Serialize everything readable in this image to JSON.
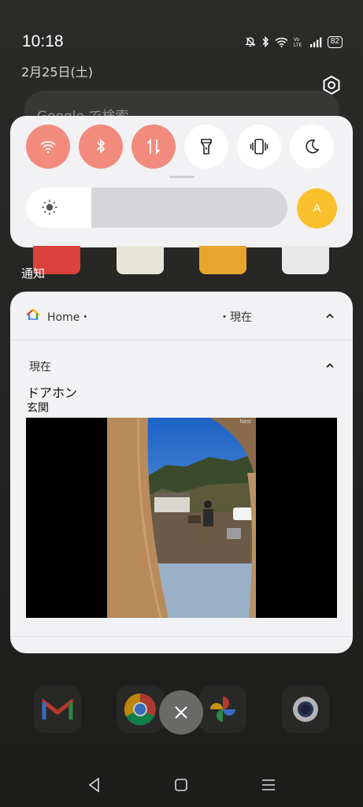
{
  "status_bar": {
    "time": "10:18",
    "battery": "82",
    "icons": [
      "mute-bell-icon",
      "bluetooth-icon",
      "wifi-icon",
      "volte-icon",
      "signal-icon",
      "battery-icon"
    ]
  },
  "date": "2月25日(土)",
  "search": {
    "placeholder": "Google で検索"
  },
  "quick_settings": {
    "tiles": [
      {
        "name": "wifi",
        "on": true
      },
      {
        "name": "bluetooth",
        "on": true
      },
      {
        "name": "mobile-data",
        "on": true
      },
      {
        "name": "flashlight",
        "on": false
      },
      {
        "name": "vibrate",
        "on": false
      },
      {
        "name": "do-not-disturb",
        "on": false
      }
    ],
    "brightness_level": 0.25,
    "auto_brightness_label": "A",
    "accent_on": "#f28b7e",
    "accent_auto": "#fbc02d"
  },
  "notifications_title": "通知",
  "notification": {
    "app_name": "Home・",
    "header_time": "・現在",
    "group_time": "現在",
    "title": "ドアホン",
    "subtitle": "玄関",
    "camera_watermark": "Nest"
  }
}
